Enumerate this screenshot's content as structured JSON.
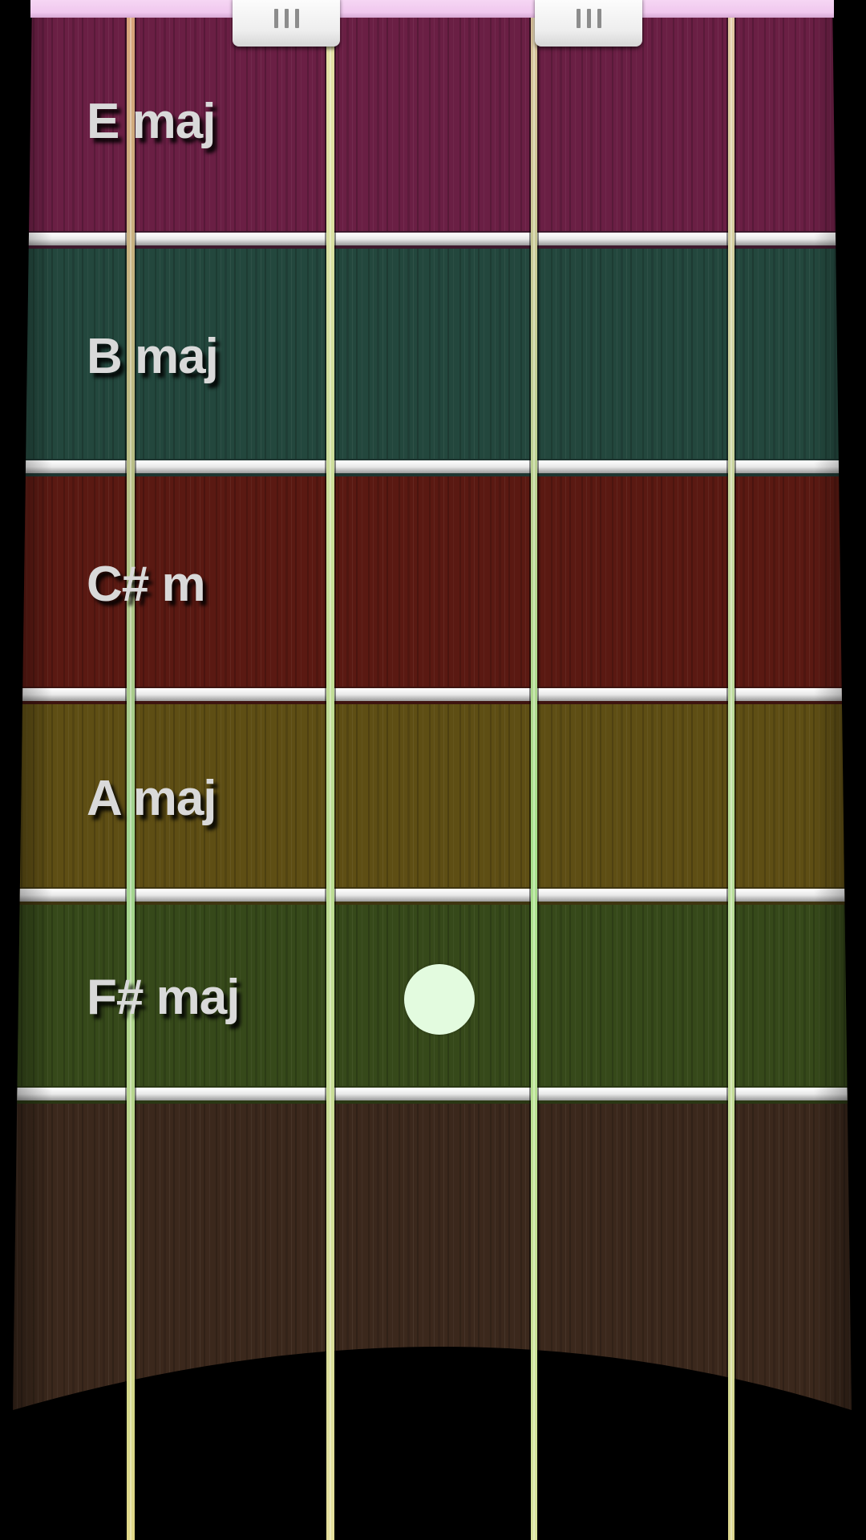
{
  "chords": [
    {
      "label": "E maj",
      "color": "#6a1f44"
    },
    {
      "label": "B maj",
      "color": "#23473d"
    },
    {
      "label": "C# m",
      "color": "#5a1912"
    },
    {
      "label": "A maj",
      "color": "#5e4e14"
    },
    {
      "label": "F# maj",
      "color": "#36491a"
    }
  ],
  "bridge_color": "#3b281c",
  "nut_color": "#f3cdf1",
  "tuning_handles": [
    {
      "name": "tuning-handle-left"
    },
    {
      "name": "tuning-handle-right"
    }
  ],
  "strings": [
    {
      "color_top": "#d9a37a",
      "color_mid": "#9fd58f",
      "color_bottom": "#e2d889"
    },
    {
      "color_top": "#e7e1a8",
      "color_mid": "#b9dc92",
      "color_bottom": "#e6df9d"
    },
    {
      "color_top": "#d8c19a",
      "color_mid": "#a7e08c",
      "color_bottom": "#d9e49b"
    },
    {
      "color_top": "#e2c9a3",
      "color_mid": "#b6df9a",
      "color_bottom": "#dcd68f"
    }
  ],
  "touch_indicator": {
    "color": "#e3fbdf"
  }
}
